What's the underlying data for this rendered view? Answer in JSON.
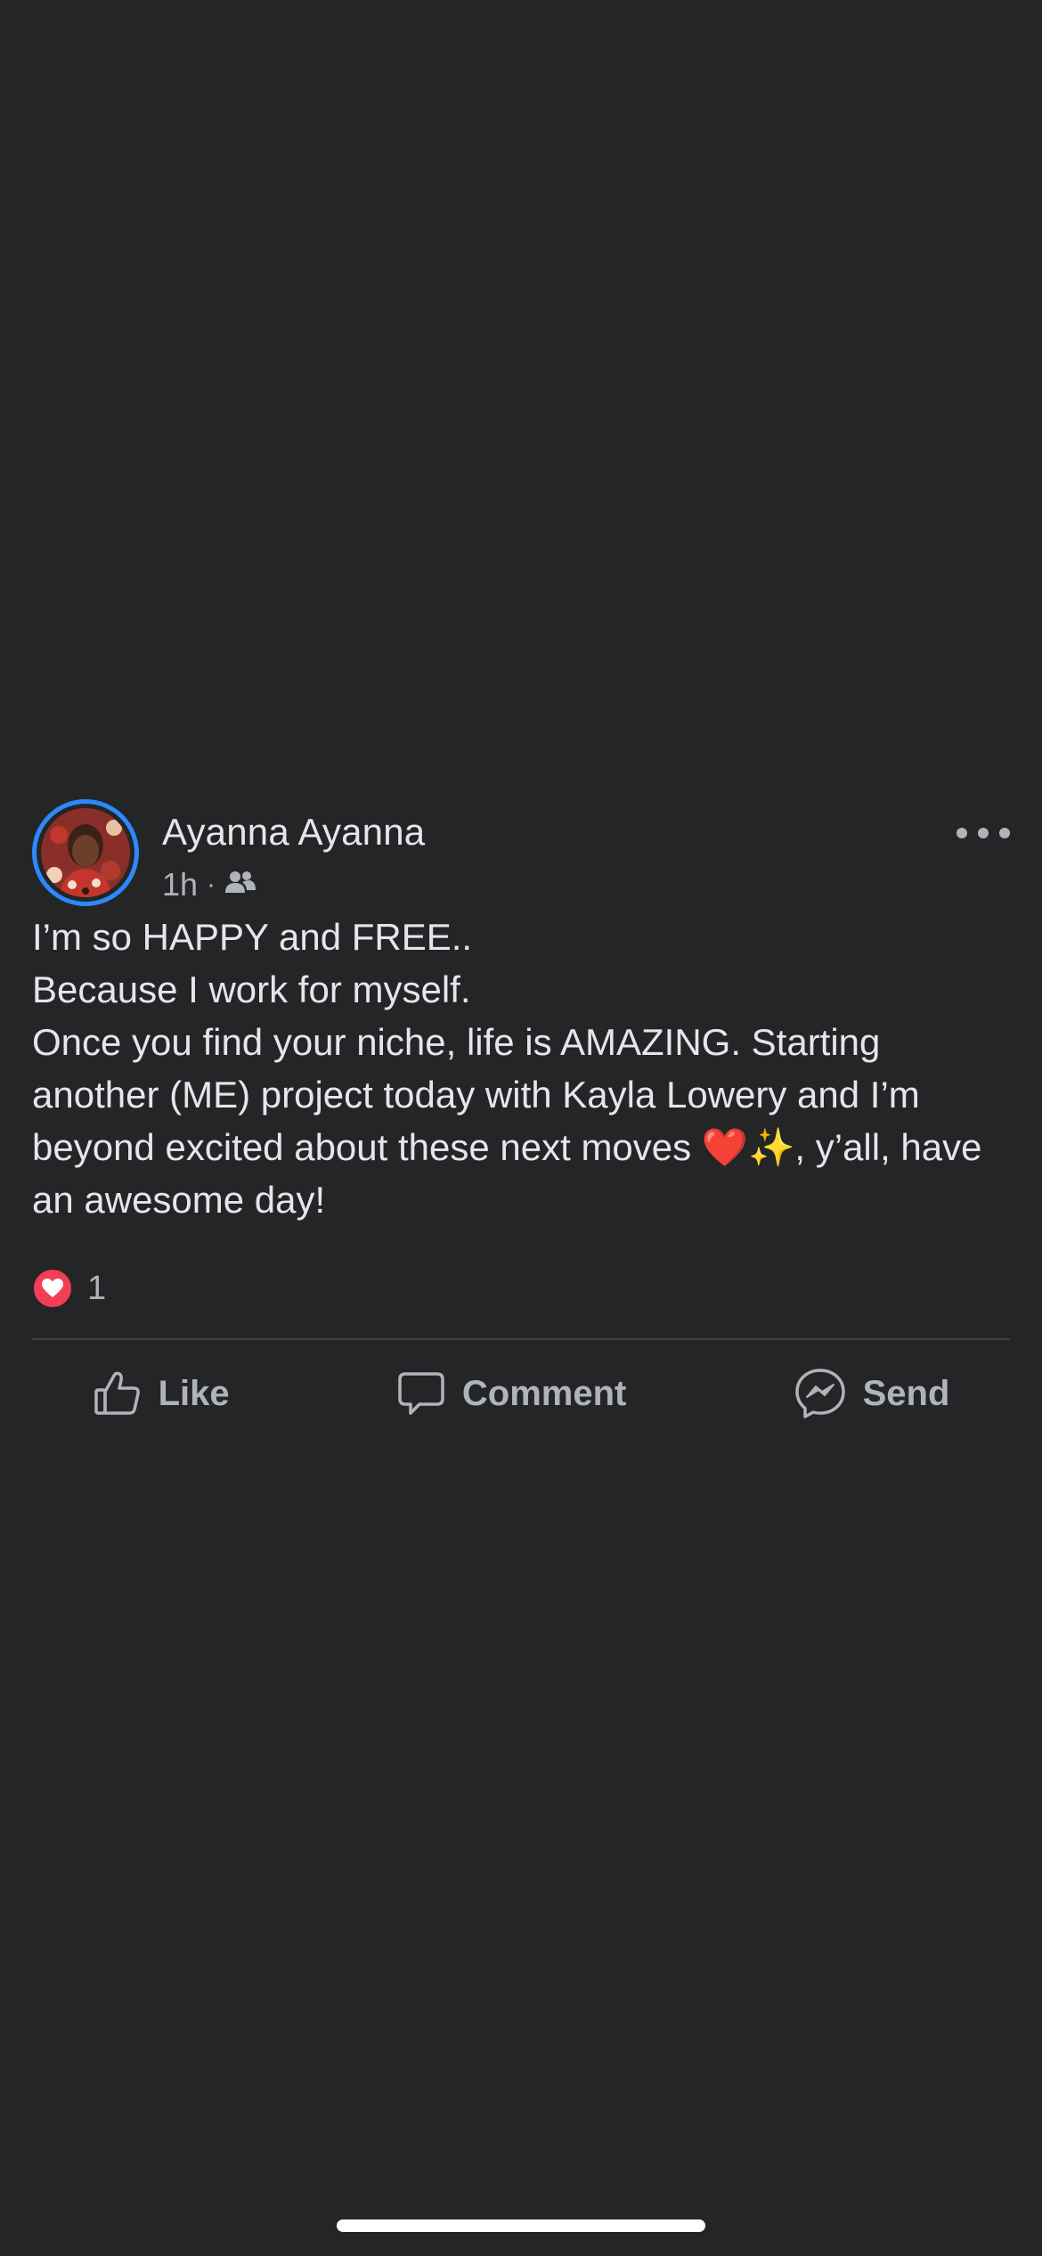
{
  "post": {
    "author": "Ayanna Ayanna",
    "time": "1h",
    "separator": "·",
    "audience_icon": "friends-icon",
    "text": "I’m so HAPPY and FREE..\nBecause I work for myself.\nOnce you find your niche, life is AMAZING. Starting another (ME) project today with Kayla Lowery and I’m beyond excited about these next moves ❤️✨, y’all, have an awesome day!",
    "reaction_icon": "love-icon",
    "reaction_count": "1",
    "actions": {
      "like": "Like",
      "comment": "Comment",
      "send": "Send"
    }
  },
  "colors": {
    "background": "#242526",
    "text": "#e4e6eb",
    "secondary_text": "#b0b3b8",
    "avatar_ring": "#2d88ff",
    "love": "#f33e58"
  }
}
